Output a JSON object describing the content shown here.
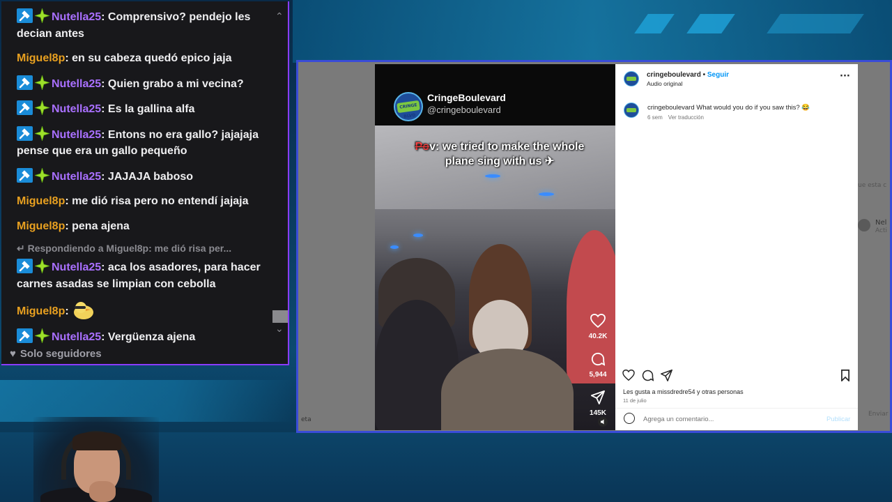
{
  "chat": {
    "messages": [
      {
        "user": "Nutella25",
        "badges": true,
        "text": "Comprensivo? pendejo les decian antes"
      },
      {
        "user": "Miguel8p",
        "badges": false,
        "text": "en su cabeza quedó epico jaja"
      },
      {
        "user": "Nutella25",
        "badges": true,
        "text": "Quien grabo a mi vecina?"
      },
      {
        "user": "Nutella25",
        "badges": true,
        "text": "Es la gallina alfa"
      },
      {
        "user": "Nutella25",
        "badges": true,
        "text": "Entons no era gallo? jajajaja pense que era un gallo pequeño"
      },
      {
        "user": "Nutella25",
        "badges": true,
        "text": "JAJAJA baboso"
      },
      {
        "user": "Miguel8p",
        "badges": false,
        "text": "me dió risa pero no entendí jajaja"
      },
      {
        "user": "Miguel8p",
        "badges": false,
        "text": "pena ajena"
      },
      {
        "user": "Nutella25",
        "badges": true,
        "reply": "Respondiendo a Miguel8p: me dió risa per...",
        "text": "aca los asadores, para hacer carnes asadas se limpian con cebolla"
      },
      {
        "user": "Miguel8p",
        "badges": false,
        "text": "",
        "emote": "duck-emote"
      },
      {
        "user": "Nutella25",
        "badges": true,
        "text": "Vergüenza ajena"
      }
    ],
    "footer_label": "Solo seguidores",
    "colors": {
      "miguel": "#e8a020",
      "nutella": "#a970ff",
      "border": "#8a3cff"
    }
  },
  "video": {
    "channel_name": "CringeBoulevard",
    "channel_handle": "@cringeboulevard",
    "logo_text": "CRINGE BLVD",
    "overlay_strike": "Po",
    "overlay_text": "v: we tried to make the whole plane sing with us",
    "likes": "40.2K",
    "comments": "5,944",
    "shares": "145K"
  },
  "instagram": {
    "username": "cringeboulevard",
    "separator": "•",
    "follow_label": "Seguir",
    "audio_label": "Audio original",
    "more_label": "···",
    "caption_user": "cringeboulevard",
    "caption_text": "What would you do if you saw this? 😂",
    "caption_age": "6 sem",
    "translate_label": "Ver traducción",
    "likes_text": "Les gusta a missdredre54 y otras personas",
    "date_text": "11 de julio",
    "comment_placeholder": "Agrega un comentario...",
    "publish_label": "Publicar"
  },
  "background": {
    "left_fragment": "eta",
    "right_fragment_1": "ue esta c",
    "right_fragment_2": "Nel",
    "right_fragment_3": "Acti",
    "right_fragment_4": "Enviar"
  }
}
